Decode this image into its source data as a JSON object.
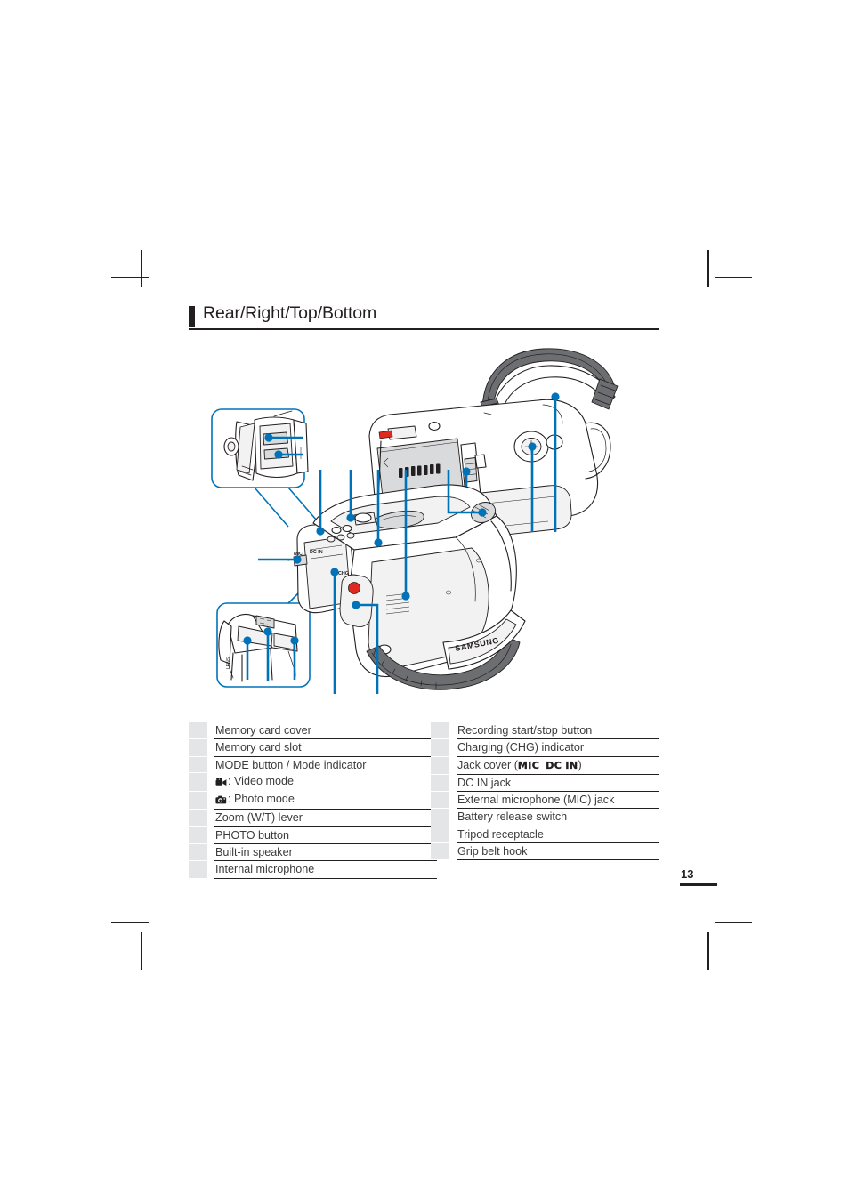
{
  "page": {
    "number": "13",
    "heading": "Rear/Right/Top/Bottom"
  },
  "colors": {
    "callout_blue": "#0073b8",
    "ink": "#231f20",
    "cell_gray": "#e3e5e6",
    "record_red": "#e0281e",
    "strap_gray": "#6d6e71"
  },
  "illustration": {
    "name": "camcorder-part-identification-diagram",
    "brand_marks": [
      "SAMSUNG",
      "SAMSUNG"
    ],
    "detail_boxes": [
      {
        "name": "memory-card-slot-detail",
        "callouts": 2
      },
      {
        "name": "bottom-tripod-detail",
        "callouts": 3
      }
    ],
    "views": [
      {
        "name": "main-right-top-view",
        "callouts": 8
      },
      {
        "name": "rear-bottom-view",
        "callouts": 3
      }
    ],
    "jack_label": "MIC  DC IN",
    "chg_label": "CHG"
  },
  "tables": {
    "left": {
      "name": "parts-list-left",
      "rows": [
        {
          "num": "",
          "label": "Memory card cover",
          "sub": false
        },
        {
          "num": "",
          "label": "Memory card slot",
          "sub": false
        },
        {
          "num": "",
          "label": "MODE button / Mode indicator",
          "sub": true
        },
        {
          "num": "",
          "label": ": Video mode",
          "sub": true,
          "icon": "video-camera-icon"
        },
        {
          "num": "",
          "label": ": Photo mode",
          "sub": false,
          "icon": "photo-camera-icon"
        },
        {
          "num": "",
          "label": "Zoom (W/T) lever",
          "sub": false
        },
        {
          "num": "",
          "label": "PHOTO button",
          "sub": false
        },
        {
          "num": "",
          "label": "Built-in speaker",
          "sub": false
        },
        {
          "num": "",
          "label": "Internal microphone",
          "sub": false
        }
      ]
    },
    "right": {
      "name": "parts-list-right",
      "rows": [
        {
          "num": "",
          "label": "Recording start/stop button"
        },
        {
          "num": "",
          "label": "Charging (CHG) indicator"
        },
        {
          "num": "",
          "label": "Jack cover (",
          "boxed_a": "MIC",
          "boxed_b": "DC IN",
          "label_end": ")"
        },
        {
          "num": "",
          "label": "DC IN jack"
        },
        {
          "num": "",
          "label": "External microphone (MIC) jack"
        },
        {
          "num": "",
          "label": "Battery release switch"
        },
        {
          "num": "",
          "label": "Tripod receptacle"
        },
        {
          "num": "",
          "label": "Grip belt hook"
        }
      ]
    }
  }
}
